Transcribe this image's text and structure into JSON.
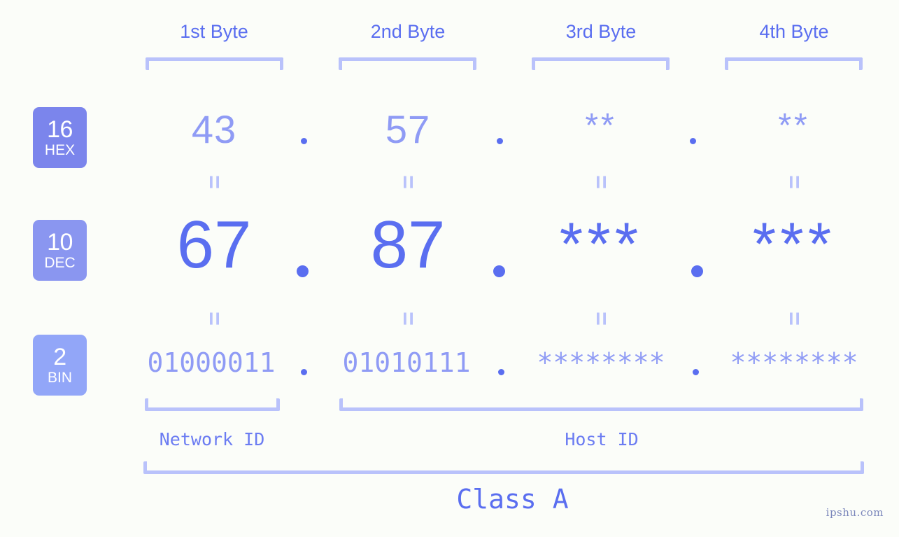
{
  "page": {
    "background_color": "#fbfdf9",
    "accent_strong": "#5a6ef0",
    "accent_light": "#8f9bf5",
    "accent_pale": "#b9c2fb",
    "watermark": "ipshu.com"
  },
  "byte_headers": [
    {
      "label": "1st Byte"
    },
    {
      "label": "2nd Byte"
    },
    {
      "label": "3rd Byte"
    },
    {
      "label": "4th Byte"
    }
  ],
  "bases": [
    {
      "radix": "16",
      "abbr": "HEX",
      "color": "#7b85ec"
    },
    {
      "radix": "10",
      "abbr": "DEC",
      "color": "#8a96f0"
    },
    {
      "radix": "2",
      "abbr": "BIN",
      "color": "#92a6f8"
    }
  ],
  "rows": {
    "hex": {
      "values": [
        "43",
        "57",
        "**",
        "**"
      ],
      "separator": "."
    },
    "dec": {
      "values": [
        "67",
        "87",
        "***",
        "***"
      ],
      "separator": "."
    },
    "bin": {
      "values": [
        "01000011",
        "01010111",
        "********",
        "********"
      ],
      "separator": "."
    }
  },
  "equals_symbol": "=",
  "segments": {
    "network_id": "Network ID",
    "host_id": "Host ID",
    "class": "Class A"
  }
}
